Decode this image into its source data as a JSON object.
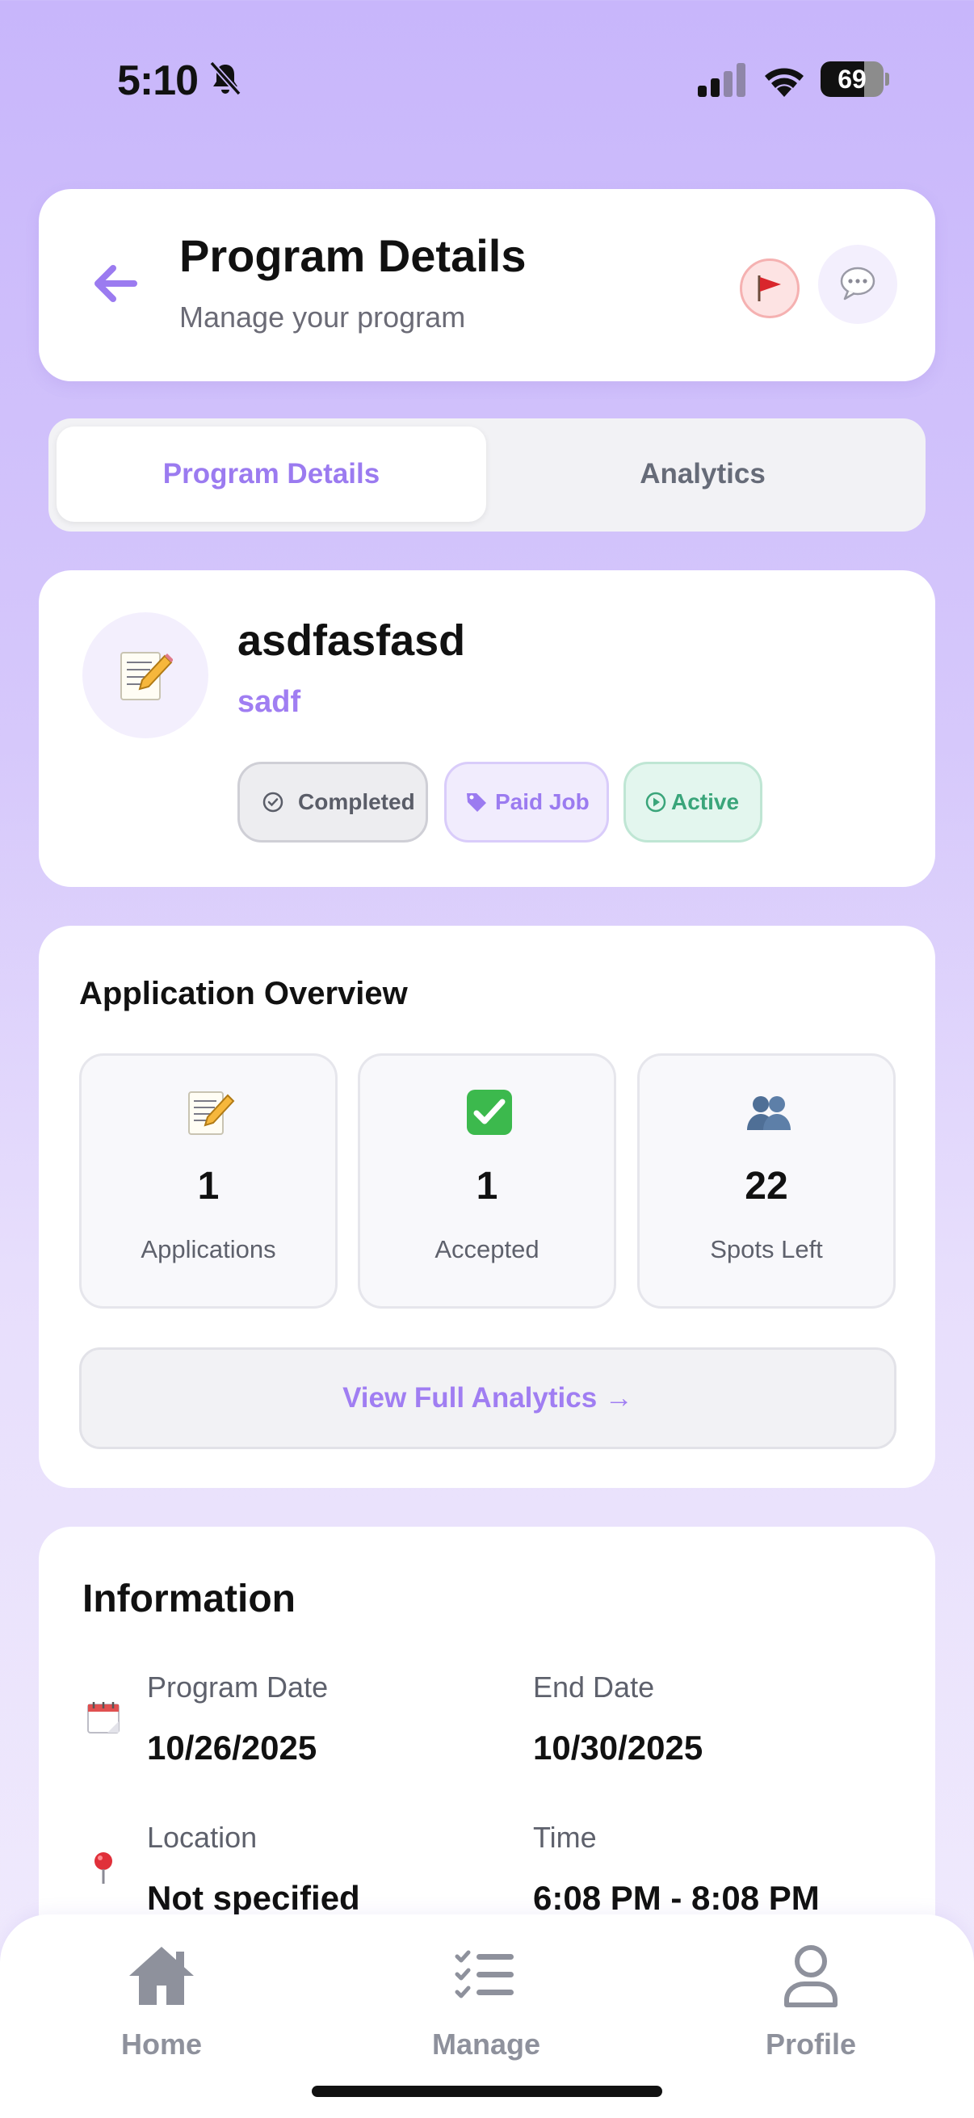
{
  "status_bar": {
    "time": "5:10",
    "battery_level": 69,
    "battery_text": "69"
  },
  "header": {
    "title": "Program Details",
    "subtitle": "Manage your program"
  },
  "tabs": [
    {
      "label": "Program Details",
      "active": true
    },
    {
      "label": "Analytics",
      "active": false
    }
  ],
  "program": {
    "name": "asdfasfasd",
    "organization": "sadf",
    "badges": [
      "Completed",
      "Paid Job",
      "Active"
    ]
  },
  "overview": {
    "title": "Application Overview",
    "stats": [
      {
        "value": "1",
        "label": "Applications",
        "icon": "memo-icon"
      },
      {
        "value": "1",
        "label": "Accepted",
        "icon": "check-mark-button-icon"
      },
      {
        "value": "22",
        "label": "Spots Left",
        "icon": "people-icon"
      }
    ],
    "analytics_button": "View Full Analytics →"
  },
  "information": {
    "title": "Information",
    "program_date_label": "Program Date",
    "program_date": "10/26/2025",
    "end_date_label": "End Date",
    "end_date": "10/30/2025",
    "location_label": "Location",
    "location": "Not specified",
    "time_label": "Time",
    "time": "6:08 PM - 8:08 PM"
  },
  "nav": [
    {
      "label": "Home",
      "icon": "home-icon"
    },
    {
      "label": "Manage",
      "icon": "checklist-icon"
    },
    {
      "label": "Profile",
      "icon": "person-icon"
    }
  ],
  "colors": {
    "accent": "#9b7bf0",
    "active_green": "#3aa57a",
    "background_top": "#c8b6fb"
  }
}
